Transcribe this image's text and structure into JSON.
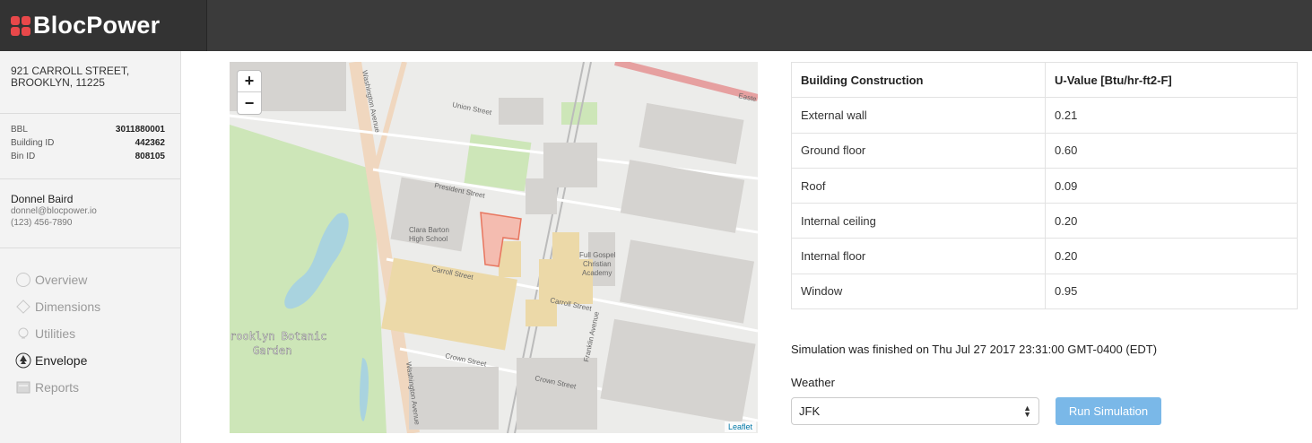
{
  "brand": {
    "name": "BlocPower",
    "accent": "#e8484a"
  },
  "sidebar": {
    "address_line1": "921 CARROLL STREET,",
    "address_line2": "BROOKLYN, 11225",
    "ids": [
      {
        "label": "BBL",
        "value": "3011880001"
      },
      {
        "label": "Building ID",
        "value": "442362"
      },
      {
        "label": "Bin ID",
        "value": "808105"
      }
    ],
    "contact": {
      "name": "Donnel Baird",
      "email": "donnel@blocpower.io",
      "phone": "(123) 456-7890"
    },
    "nav": [
      {
        "label": "Overview",
        "icon": "circle-icon"
      },
      {
        "label": "Dimensions",
        "icon": "ruler-icon"
      },
      {
        "label": "Utilities",
        "icon": "bulb-icon"
      },
      {
        "label": "Envelope",
        "icon": "tree-icon",
        "active": true
      },
      {
        "label": "Reports",
        "icon": "report-icon"
      }
    ]
  },
  "map": {
    "zoom_in": "+",
    "zoom_out": "−",
    "attribution": "Leaflet",
    "labels": {
      "washington_avenue_top": "Washington Avenue",
      "washington_avenue_bottom": "Washington Avenue",
      "union_street": "Union Street",
      "president_street": "President Street",
      "carroll_street_1": "Carroll Street",
      "carroll_street_2": "Carroll Street",
      "crown_street_1": "Crown Street",
      "crown_street_2": "Crown Street",
      "franklin_avenue": "Franklin Avenue",
      "clara_barton_1": "Clara Barton",
      "clara_barton_2": "High School",
      "full_gospel_1": "Full Gospel",
      "full_gospel_2": "Christian",
      "full_gospel_3": "Academy",
      "botanic_1": "rooklyn Botanic",
      "botanic_2": "Garden",
      "easter": "Easte"
    }
  },
  "table": {
    "headers": [
      "Building Construction",
      "U-Value [Btu/hr-ft2-F]"
    ],
    "rows": [
      [
        "External wall",
        "0.21"
      ],
      [
        "Ground floor",
        "0.60"
      ],
      [
        "Roof",
        "0.09"
      ],
      [
        "Internal ceiling",
        "0.20"
      ],
      [
        "Internal floor",
        "0.20"
      ],
      [
        "Window",
        "0.95"
      ]
    ]
  },
  "simulation": {
    "message": "Simulation was finished on Thu Jul 27 2017 23:31:00 GMT-0400 (EDT)",
    "weather_label": "Weather",
    "weather_value": "JFK",
    "run_label": "Run Simulation"
  }
}
